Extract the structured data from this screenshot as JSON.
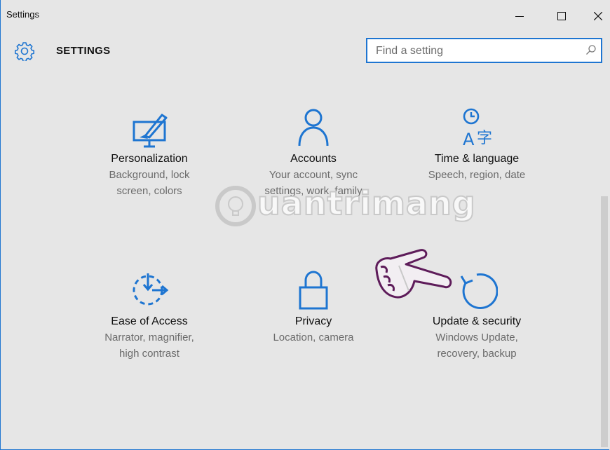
{
  "window": {
    "title": "Settings"
  },
  "controls": {
    "minimize": "–",
    "maximize": "☐",
    "close": "✕"
  },
  "header": {
    "title": "SETTINGS",
    "icon": "gear-icon"
  },
  "search": {
    "placeholder": "Find a setting",
    "value": "",
    "icon": "search-icon"
  },
  "tiles": [
    {
      "name": "Personalization",
      "desc": [
        "Background, lock",
        "screen, colors"
      ],
      "icon": "personalization-icon"
    },
    {
      "name": "Accounts",
      "desc": [
        "Your account, sync",
        "settings, work, family"
      ],
      "icon": "accounts-icon"
    },
    {
      "name": "Time & language",
      "desc": [
        "Speech, region, date"
      ],
      "icon": "time-language-icon"
    },
    {
      "name": "Ease of Access",
      "desc": [
        "Narrator, magnifier,",
        "high contrast"
      ],
      "icon": "ease-of-access-icon"
    },
    {
      "name": "Privacy",
      "desc": [
        "Location, camera"
      ],
      "icon": "privacy-icon"
    },
    {
      "name": "Update & security",
      "desc": [
        "Windows Update,",
        "recovery, backup"
      ],
      "icon": "update-security-icon"
    }
  ],
  "watermark": {
    "text": "uantrimang"
  },
  "colors": {
    "accent": "#1e75d1",
    "background": "#e6e6e6",
    "text": "#111111",
    "secondary_text": "#6b6b6b"
  }
}
